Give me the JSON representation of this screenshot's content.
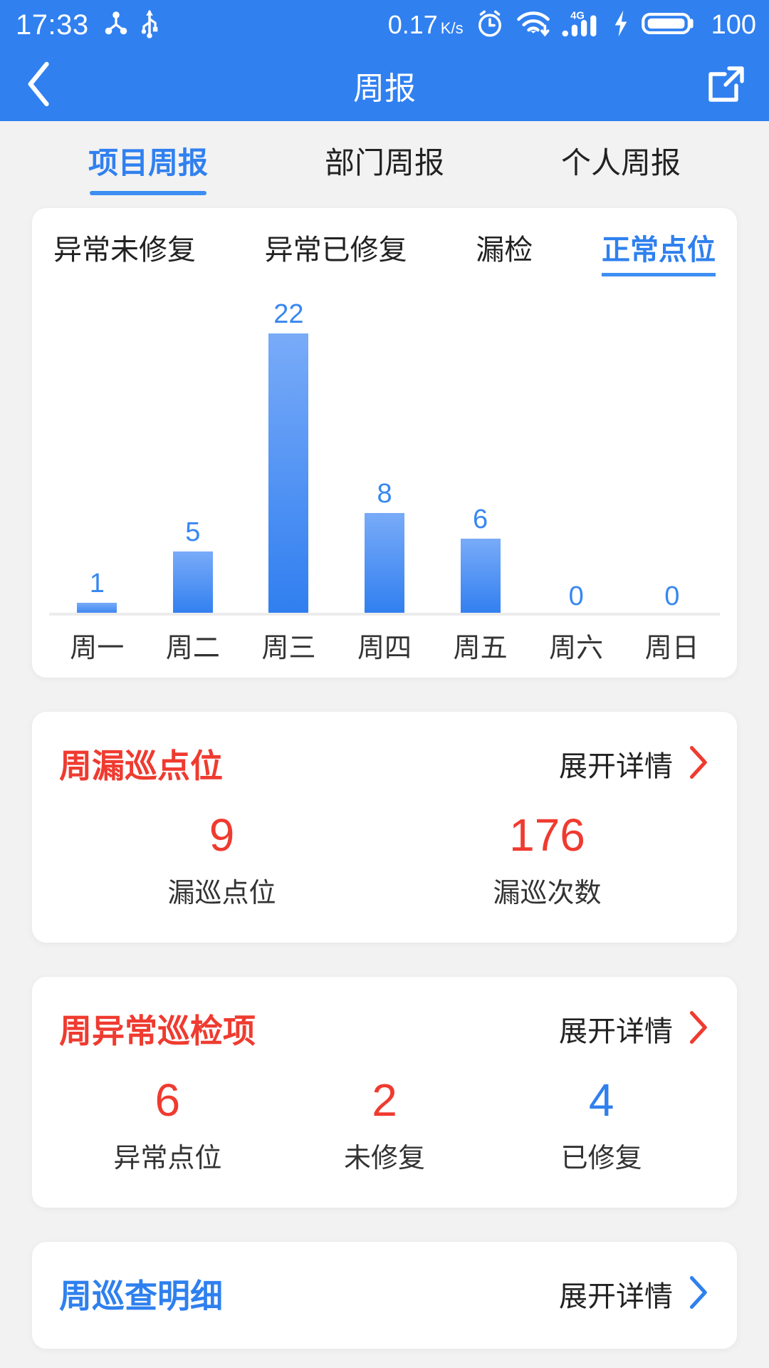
{
  "statusbar": {
    "time": "17:33",
    "network_speed": "0.17",
    "speed_unit": "K/s",
    "battery_level": "100",
    "icons": [
      "share-nodes-icon",
      "usb-icon",
      "alarm-clock-icon",
      "wifi-icon",
      "4g-signal-icon",
      "charging-bolt-icon",
      "battery-icon"
    ],
    "signal_label": "4G"
  },
  "navbar": {
    "title": "周报",
    "back_icon": "chevron-left-icon",
    "share_icon": "external-link-icon"
  },
  "toptabs": [
    {
      "label": "项目周报",
      "active": true
    },
    {
      "label": "部门周报",
      "active": false
    },
    {
      "label": "个人周报",
      "active": false
    }
  ],
  "chart_tabs": [
    {
      "label": "异常未修复",
      "active": false
    },
    {
      "label": "异常已修复",
      "active": false
    },
    {
      "label": "漏检",
      "active": false
    },
    {
      "label": "正常点位",
      "active": true
    }
  ],
  "chart_data": {
    "type": "bar",
    "title": "正常点位",
    "categories": [
      "周一",
      "周二",
      "周三",
      "周四",
      "周五",
      "周六",
      "周日"
    ],
    "values": [
      1,
      5,
      22,
      8,
      6,
      0,
      0
    ],
    "xlabel": "",
    "ylabel": "",
    "ylim": [
      0,
      22
    ],
    "grid": false,
    "legend": "none",
    "bar_color_top": "#79abf8",
    "bar_color_bottom": "#2f7ef0",
    "label_color": "#3787f1"
  },
  "colors": {
    "brand_blue": "#3080f0",
    "accent_blue": "#2f80ee",
    "alert_red": "#ef3b30",
    "page_bg": "#f2f2f2",
    "card_bg": "#ffffff"
  },
  "cards": [
    {
      "title": "周漏巡点位",
      "title_color": "red",
      "detail_label": "展开详情",
      "chevron_color": "red",
      "stats": [
        {
          "value": "9",
          "label": "漏巡点位",
          "color": "red"
        },
        {
          "value": "176",
          "label": "漏巡次数",
          "color": "red"
        }
      ]
    },
    {
      "title": "周异常巡检项",
      "title_color": "red",
      "detail_label": "展开详情",
      "chevron_color": "red",
      "stats": [
        {
          "value": "6",
          "label": "异常点位",
          "color": "red"
        },
        {
          "value": "2",
          "label": "未修复",
          "color": "red"
        },
        {
          "value": "4",
          "label": "已修复",
          "color": "blue"
        }
      ]
    },
    {
      "title": "周巡查明细",
      "title_color": "blue",
      "detail_label": "展开详情",
      "chevron_color": "blue",
      "stats": []
    }
  ]
}
